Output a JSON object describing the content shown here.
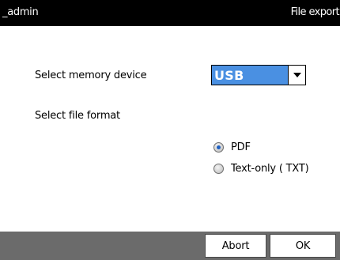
{
  "titlebar": {
    "user": "_admin",
    "screen_title": "File export"
  },
  "form": {
    "memory_label": "Select memory device",
    "memory_device": {
      "selected": "USB",
      "dropdown_icon": "triangle-down-icon"
    },
    "format_label": "Select file format",
    "formats": [
      {
        "label": "PDF",
        "checked": true
      },
      {
        "label": "Text-only ( TXT)",
        "checked": false
      }
    ]
  },
  "footer": {
    "abort_label": "Abort",
    "ok_label": "OK"
  },
  "colors": {
    "titlebar_bg": "#000000",
    "select_bg": "#4a90e2",
    "footer_bg": "#6b6b6b"
  }
}
